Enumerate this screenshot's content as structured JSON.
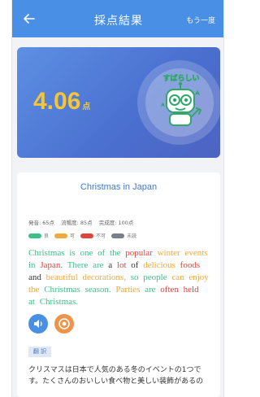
{
  "nav": {
    "title": "採点結果",
    "retry_label": "もう一度"
  },
  "result": {
    "score": "4.06",
    "unit": "点",
    "mascot_text": "すばらしい"
  },
  "passage_card": {
    "title": "Christmas in Japan",
    "stats": [
      {
        "label": "発音: 65点"
      },
      {
        "label": "流暢度: 85点"
      },
      {
        "label": "完成度: 100点"
      }
    ],
    "legend": [
      {
        "label": "良",
        "color": "#3cbf8a"
      },
      {
        "label": "可",
        "color": "#f2a93b"
      },
      {
        "label": "不可",
        "color": "#e0443e"
      },
      {
        "label": "未読",
        "color": "#7a7f87"
      }
    ],
    "words": [
      {
        "text": "Christmas",
        "color": "#3cbf8a"
      },
      {
        "text": "is",
        "color": "#3cbf8a"
      },
      {
        "text": "one",
        "color": "#3cbf8a"
      },
      {
        "text": "of",
        "color": "#3cbf8a"
      },
      {
        "text": "the",
        "color": "#3cbf8a"
      },
      {
        "text": "popular",
        "color": "#e0443e"
      },
      {
        "text": "winter",
        "color": "#f2a93b"
      },
      {
        "text": "events",
        "color": "#f2a93b"
      },
      {
        "text": "in",
        "color": "#3cbf8a"
      },
      {
        "text": "Japan.",
        "color": "#e0443e"
      },
      {
        "text": "There",
        "color": "#3cbf8a"
      },
      {
        "text": "are",
        "color": "#3cbf8a"
      },
      {
        "text": "a",
        "color": "#333333"
      },
      {
        "text": "lot",
        "color": "#e0443e"
      },
      {
        "text": "of",
        "color": "#333333"
      },
      {
        "text": "delicious",
        "color": "#f2a93b"
      },
      {
        "text": "foods",
        "color": "#e0443e"
      },
      {
        "text": "and",
        "color": "#333333"
      },
      {
        "text": "beautiful",
        "color": "#f2a93b"
      },
      {
        "text": "decorations,",
        "color": "#f2a93b"
      },
      {
        "text": "so",
        "color": "#3cbf8a"
      },
      {
        "text": "people",
        "color": "#3cbf8a"
      },
      {
        "text": "can",
        "color": "#f2a93b"
      },
      {
        "text": "enjoy",
        "color": "#f2a93b"
      },
      {
        "text": "the",
        "color": "#f2a93b"
      },
      {
        "text": "Christmas",
        "color": "#3cbf8a"
      },
      {
        "text": "season.",
        "color": "#3cbf8a"
      },
      {
        "text": "Parties",
        "color": "#f2a93b"
      },
      {
        "text": "are",
        "color": "#3cbf8a"
      },
      {
        "text": "often",
        "color": "#e0443e"
      },
      {
        "text": "held",
        "color": "#e0443e"
      },
      {
        "text": "at",
        "color": "#3cbf8a"
      },
      {
        "text": "Christmas.",
        "color": "#3cbf8a"
      }
    ],
    "translate_label": "翻 訳",
    "translation": "クリスマスは日本で人気のある冬のイベントの1つです。たくさんのおいしい食べ物と美しい装飾があるの"
  },
  "colors": {
    "nav_bg": "#4a8fe6",
    "score": "#f6c532",
    "accent": "#3b7bd8"
  },
  "icons": {
    "back": "arrow-left-icon",
    "audio": "speaker-icon",
    "record": "record-icon"
  }
}
